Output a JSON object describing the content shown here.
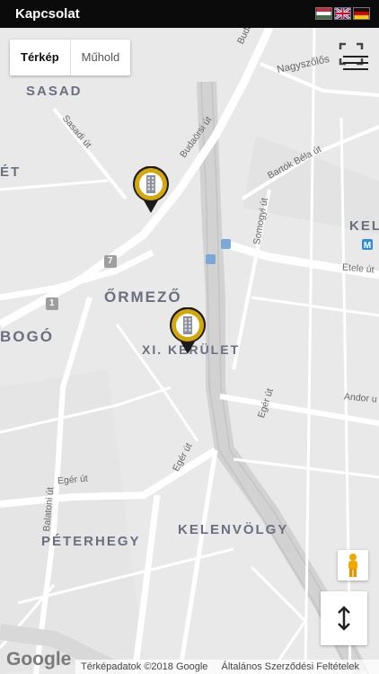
{
  "app": {
    "title": "Kapcsolat"
  },
  "flags": [
    "hungary-flag",
    "uk-flag",
    "germany-flag"
  ],
  "map_type": {
    "map": "Térkép",
    "satellite": "Műhold"
  },
  "districts": {
    "sasad": "SASAD",
    "ormezo": "ŐRMEZŐ",
    "bogo": "BOGÓ",
    "xi": "XI. KERÜLET",
    "peterhegy": "PÉTERHEGY",
    "kelenvolgy": "KELENVÖLGY",
    "kel": "KEL",
    "et": "ÉT"
  },
  "streets": {
    "budaorsi": "Budaörsi út",
    "budaorsi2": "Budaörsi út",
    "nagyszolos": "Nagyszőlős",
    "sasadi": "Sasadi út",
    "bartok": "Bartók Béla út",
    "somogyi": "Somogyi út",
    "etele": "Etele út",
    "andor": "Andor u",
    "eger": "Egér út",
    "eger2": "Egér út",
    "eger3": "Egér út",
    "balatoni": "Balatoni út"
  },
  "road_numbers": {
    "r7": "7",
    "r1": "1"
  },
  "footer": {
    "logo": "Google",
    "mapdata": "Térképadatok ©2018 Google",
    "terms": "Általános Szerződési Feltételek"
  },
  "colors": {
    "pin_gold": "#d4a80a",
    "topbar": "#0b0b0b",
    "map_bg": "#e9e9e9"
  }
}
